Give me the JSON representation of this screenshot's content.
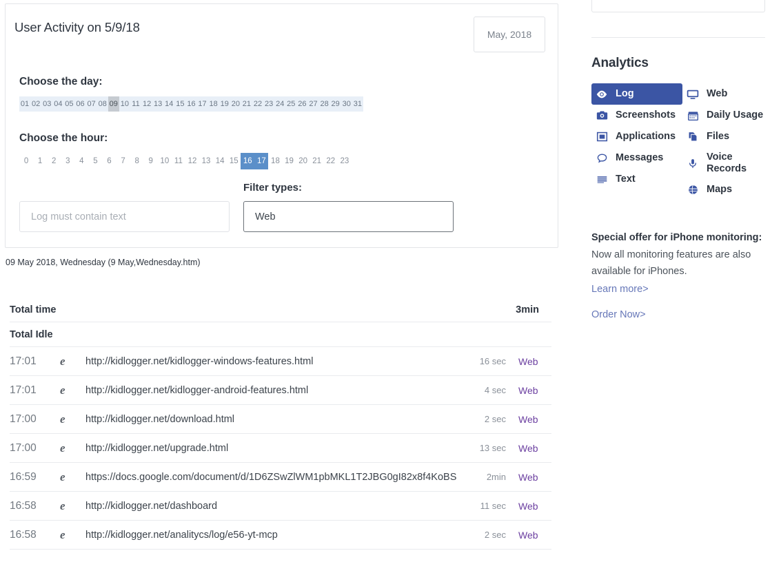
{
  "main": {
    "panel_title": "User Activity on 5/9/18",
    "month_button": "May, 2018",
    "day_label": "Choose the day:",
    "days": [
      "01",
      "02",
      "03",
      "04",
      "05",
      "06",
      "07",
      "08",
      "09",
      "10",
      "11",
      "12",
      "13",
      "14",
      "15",
      "16",
      "17",
      "18",
      "19",
      "20",
      "21",
      "22",
      "23",
      "24",
      "25",
      "26",
      "27",
      "28",
      "29",
      "30",
      "31"
    ],
    "selected_day": "09",
    "hour_label": "Choose the hour:",
    "hours": [
      "0",
      "1",
      "2",
      "3",
      "4",
      "5",
      "6",
      "7",
      "8",
      "9",
      "10",
      "11",
      "12",
      "13",
      "14",
      "15",
      "16",
      "17",
      "18",
      "19",
      "20",
      "21",
      "22",
      "23"
    ],
    "selected_hours": [
      "16",
      "17"
    ],
    "search_placeholder": "Log must contain text",
    "search_value": "",
    "filter_caption": "Filter types:",
    "filter_value": "Web",
    "date_caption": "09 May 2018, Wednesday (9 May,Wednesday.htm)"
  },
  "table": {
    "total_time_label": "Total time",
    "total_time_value": "3min",
    "total_idle_label": "Total Idle",
    "total_idle_value": "",
    "rows": [
      {
        "time": "17:01",
        "icon": "internet-explorer-icon",
        "url": "http://kidlogger.net/kidlogger-windows-features.html",
        "duration": "16 sec",
        "type": "Web"
      },
      {
        "time": "17:01",
        "icon": "internet-explorer-icon",
        "url": "http://kidlogger.net/kidlogger-android-features.html",
        "duration": "4 sec",
        "type": "Web"
      },
      {
        "time": "17:00",
        "icon": "internet-explorer-icon",
        "url": "http://kidlogger.net/download.html",
        "duration": "2 sec",
        "type": "Web"
      },
      {
        "time": "17:00",
        "icon": "internet-explorer-icon",
        "url": "http://kidlogger.net/upgrade.html",
        "duration": "13 sec",
        "type": "Web"
      },
      {
        "time": "16:59",
        "icon": "internet-explorer-icon",
        "url": "https://docs.google.com/document/d/1D6ZSwZlWM1pbMKL1T2JBG0gI82x8f4KoBS",
        "duration": "2min",
        "type": "Web"
      },
      {
        "time": "16:58",
        "icon": "internet-explorer-icon",
        "url": "http://kidlogger.net/dashboard",
        "duration": "11 sec",
        "type": "Web"
      },
      {
        "time": "16:58",
        "icon": "internet-explorer-icon",
        "url": "http://kidlogger.net/analitycs/log/e56-yt-mcp",
        "duration": "2 sec",
        "type": "Web"
      }
    ]
  },
  "sidebar": {
    "analytics_title": "Analytics",
    "nav_left": [
      {
        "label": "Log",
        "icon": "eye-icon",
        "active": true
      },
      {
        "label": "Screenshots",
        "icon": "camera-icon",
        "active": false
      },
      {
        "label": "Applications",
        "icon": "application-window-icon",
        "active": false
      },
      {
        "label": "Messages",
        "icon": "chat-bubble-icon",
        "active": false
      },
      {
        "label": "Text",
        "icon": "text-lines-icon",
        "active": false
      }
    ],
    "nav_right": [
      {
        "label": "Web",
        "icon": "monitor-icon",
        "active": false
      },
      {
        "label": "Daily Usage",
        "icon": "calendar-icon",
        "active": false
      },
      {
        "label": "Files",
        "icon": "files-icon",
        "active": false
      },
      {
        "label": "Voice\nRecords",
        "icon": "microphone-icon",
        "active": false
      },
      {
        "label": "Maps",
        "icon": "globe-icon",
        "active": false
      }
    ],
    "offer_title": "Special offer for iPhone monitoring:",
    "offer_text": "Now all monitoring features are also available for iPhones.",
    "learn_more": "Learn more>",
    "order_now": "Order Now>"
  },
  "colors": {
    "accent_blue": "#3b55a4",
    "hour_selected": "#5b8fc9",
    "day_strip_bg": "#e8eff7",
    "day_selected": "#c6cbd1",
    "link_purple": "#6b3fa0",
    "offer_link": "#6677b8"
  }
}
